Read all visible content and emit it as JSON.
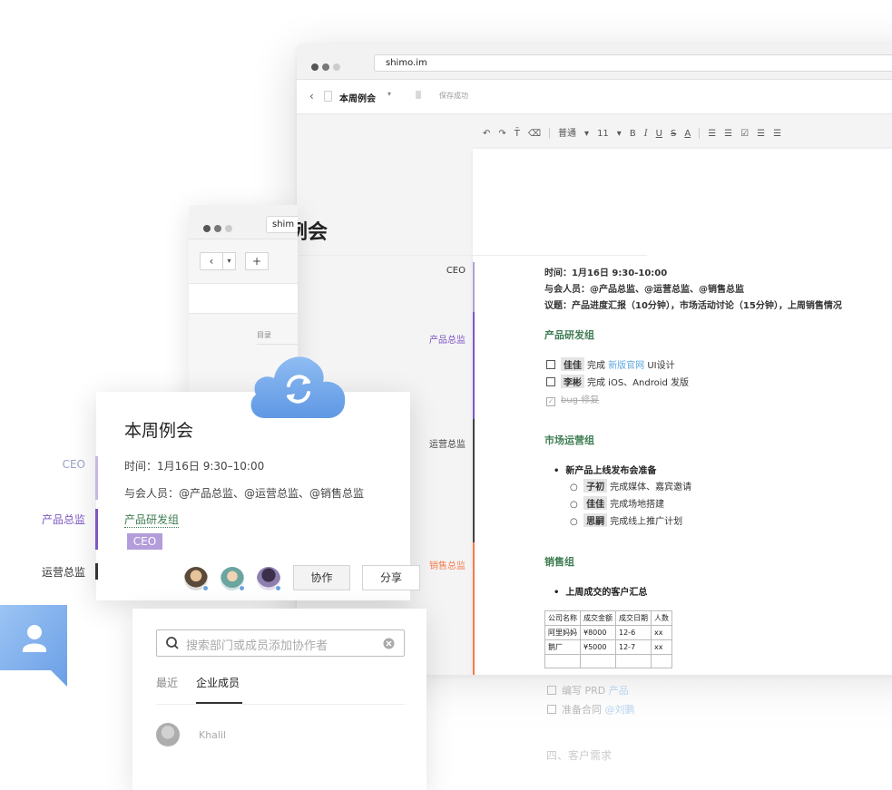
{
  "main_window": {
    "url": "shimo.im",
    "doc_title": "本周例会",
    "save_status": "保存成功"
  },
  "toolbar": {
    "undo_icon": "↶",
    "redo_icon": "↷",
    "format_paint_icon": "T̄",
    "clear_format_icon": "⌫",
    "paragraph_style": "普通",
    "font_size": "11",
    "bold": "B",
    "italic": "I",
    "underline": "U",
    "strike": "S",
    "font_color": "A",
    "ordered_list": "☰",
    "bullet_list": "☰",
    "checklist": "☑",
    "indent": "☰",
    "outdent": "☰"
  },
  "document": {
    "title": "本周例会",
    "meta_time": "时间：1月16日 9:30-10:00",
    "meta_attendees": "与会人员：@产品总监、@运营总监、@销售总监",
    "meta_agenda": "议题：产品进度汇报（10分钟），市场活动讨论（15分钟），上周销售情况",
    "section_product": "产品研发组",
    "tasks_product": [
      {
        "assignee": "佳佳",
        "pre": "完成 ",
        "link": "新版官网",
        "post": " UI设计",
        "checked": false
      },
      {
        "assignee": "李彬",
        "pre": "完成 iOS、Android 发版",
        "link": "",
        "post": "",
        "checked": false
      },
      {
        "assignee": "",
        "pre": "bug 修复",
        "link": "",
        "post": "",
        "checked": true
      }
    ],
    "section_ops": "市场运营组",
    "ops_bullet": "新产品上线发布会准备",
    "ops_sub": [
      {
        "assignee": "子初",
        "text": "完成媒体、嘉宾邀请"
      },
      {
        "assignee": "佳佳",
        "text": "完成场地搭建"
      },
      {
        "assignee": "思嗣",
        "text": "完成线上推广计划"
      }
    ],
    "section_sales": "销售组",
    "sales_bullet": "上周成交的客户汇总",
    "table_headers": [
      "公司名称",
      "成交金额",
      "成交日期",
      "人数"
    ],
    "table_rows": [
      [
        "阿里妈妈",
        "¥8000",
        "12-6",
        "xx"
      ],
      [
        "鹅厂",
        "¥5000",
        "12-7",
        "xx"
      ]
    ],
    "faded_tasks": [
      {
        "pre": "编写 PRD ",
        "link": "产品"
      },
      {
        "pre": "准备合同 ",
        "link": "@刘鹏"
      }
    ],
    "faded_heading": "四、客户需求"
  },
  "margin_labels": {
    "ceo": "CEO",
    "product": "产品总监",
    "ops": "运营总监",
    "sales": "销售总监"
  },
  "colors": {
    "ceo": "#b39ddb",
    "product": "#7e57c2",
    "ops": "#444444",
    "sales": "#f47c4c",
    "section_green": "#3e7c52",
    "link_blue": "#5fa6e0",
    "cloud_blue": "#6fa8ea"
  },
  "secondary_window": {
    "url": "shim",
    "back": "‹",
    "caret": "▾",
    "add": "+",
    "toc_label": "目录"
  },
  "card": {
    "title": "本周例会",
    "time": "时间：1月16日 9:30–10:00",
    "attendees": "与会人员：@产品总监、@运营总监、@销售总监",
    "group": "产品研发组",
    "ceo_tag": "CEO",
    "collab_button": "协作",
    "share_button": "分享"
  },
  "share_panel": {
    "search_placeholder": "搜索部门或成员添加协作者",
    "tab_recent": "最近",
    "tab_members": "企业成员",
    "member_name": "Khalil"
  },
  "icons": {
    "cloud": "cloud-sync-icon",
    "bubble": "user-chat-icon",
    "search": "search-icon",
    "clear": "clear-icon"
  }
}
